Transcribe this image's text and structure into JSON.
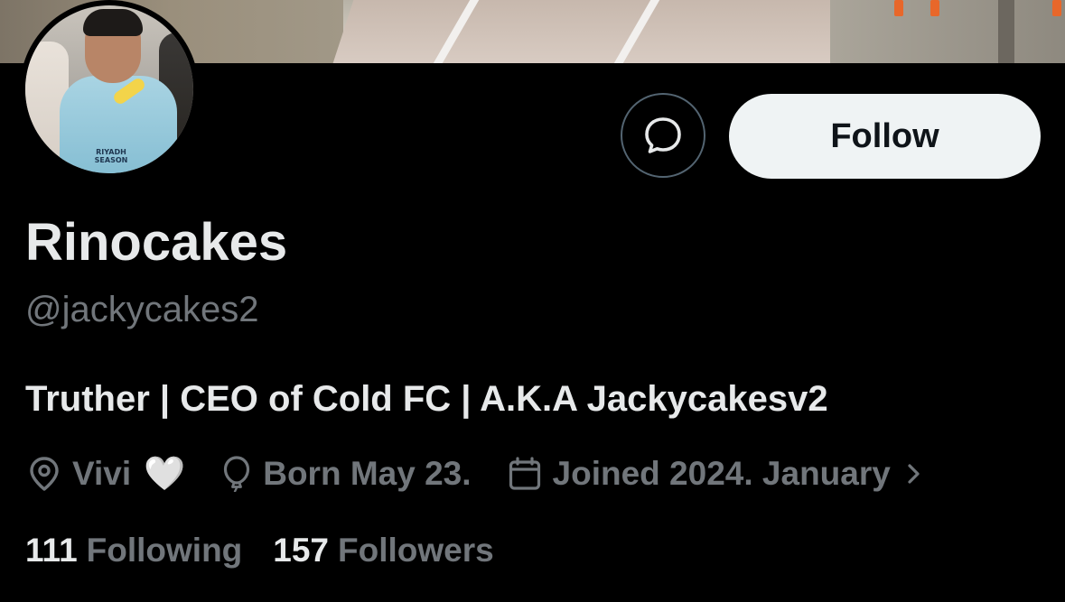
{
  "profile": {
    "display_name": "Rinocakes",
    "handle": "@jackycakes2",
    "bio": "Truther | CEO of Cold FC | A.K.A Jackycakesv2",
    "avatar_jersey_text": "RIYADH\nSEASON"
  },
  "actions": {
    "follow_label": "Follow",
    "message_icon": "message-bubble-icon"
  },
  "meta": {
    "location": "Vivi",
    "location_emoji": "🤍",
    "birthday": "Born May 23.",
    "joined": "Joined 2024. January"
  },
  "stats": {
    "following_count": "111",
    "following_label": "Following",
    "followers_count": "157",
    "followers_label": "Followers"
  },
  "colors": {
    "background": "#000000",
    "primary_text": "#e7e9ea",
    "secondary_text": "#71767b",
    "follow_button_bg": "#eff3f4",
    "follow_button_text": "#0f1419",
    "border": "#536471"
  }
}
